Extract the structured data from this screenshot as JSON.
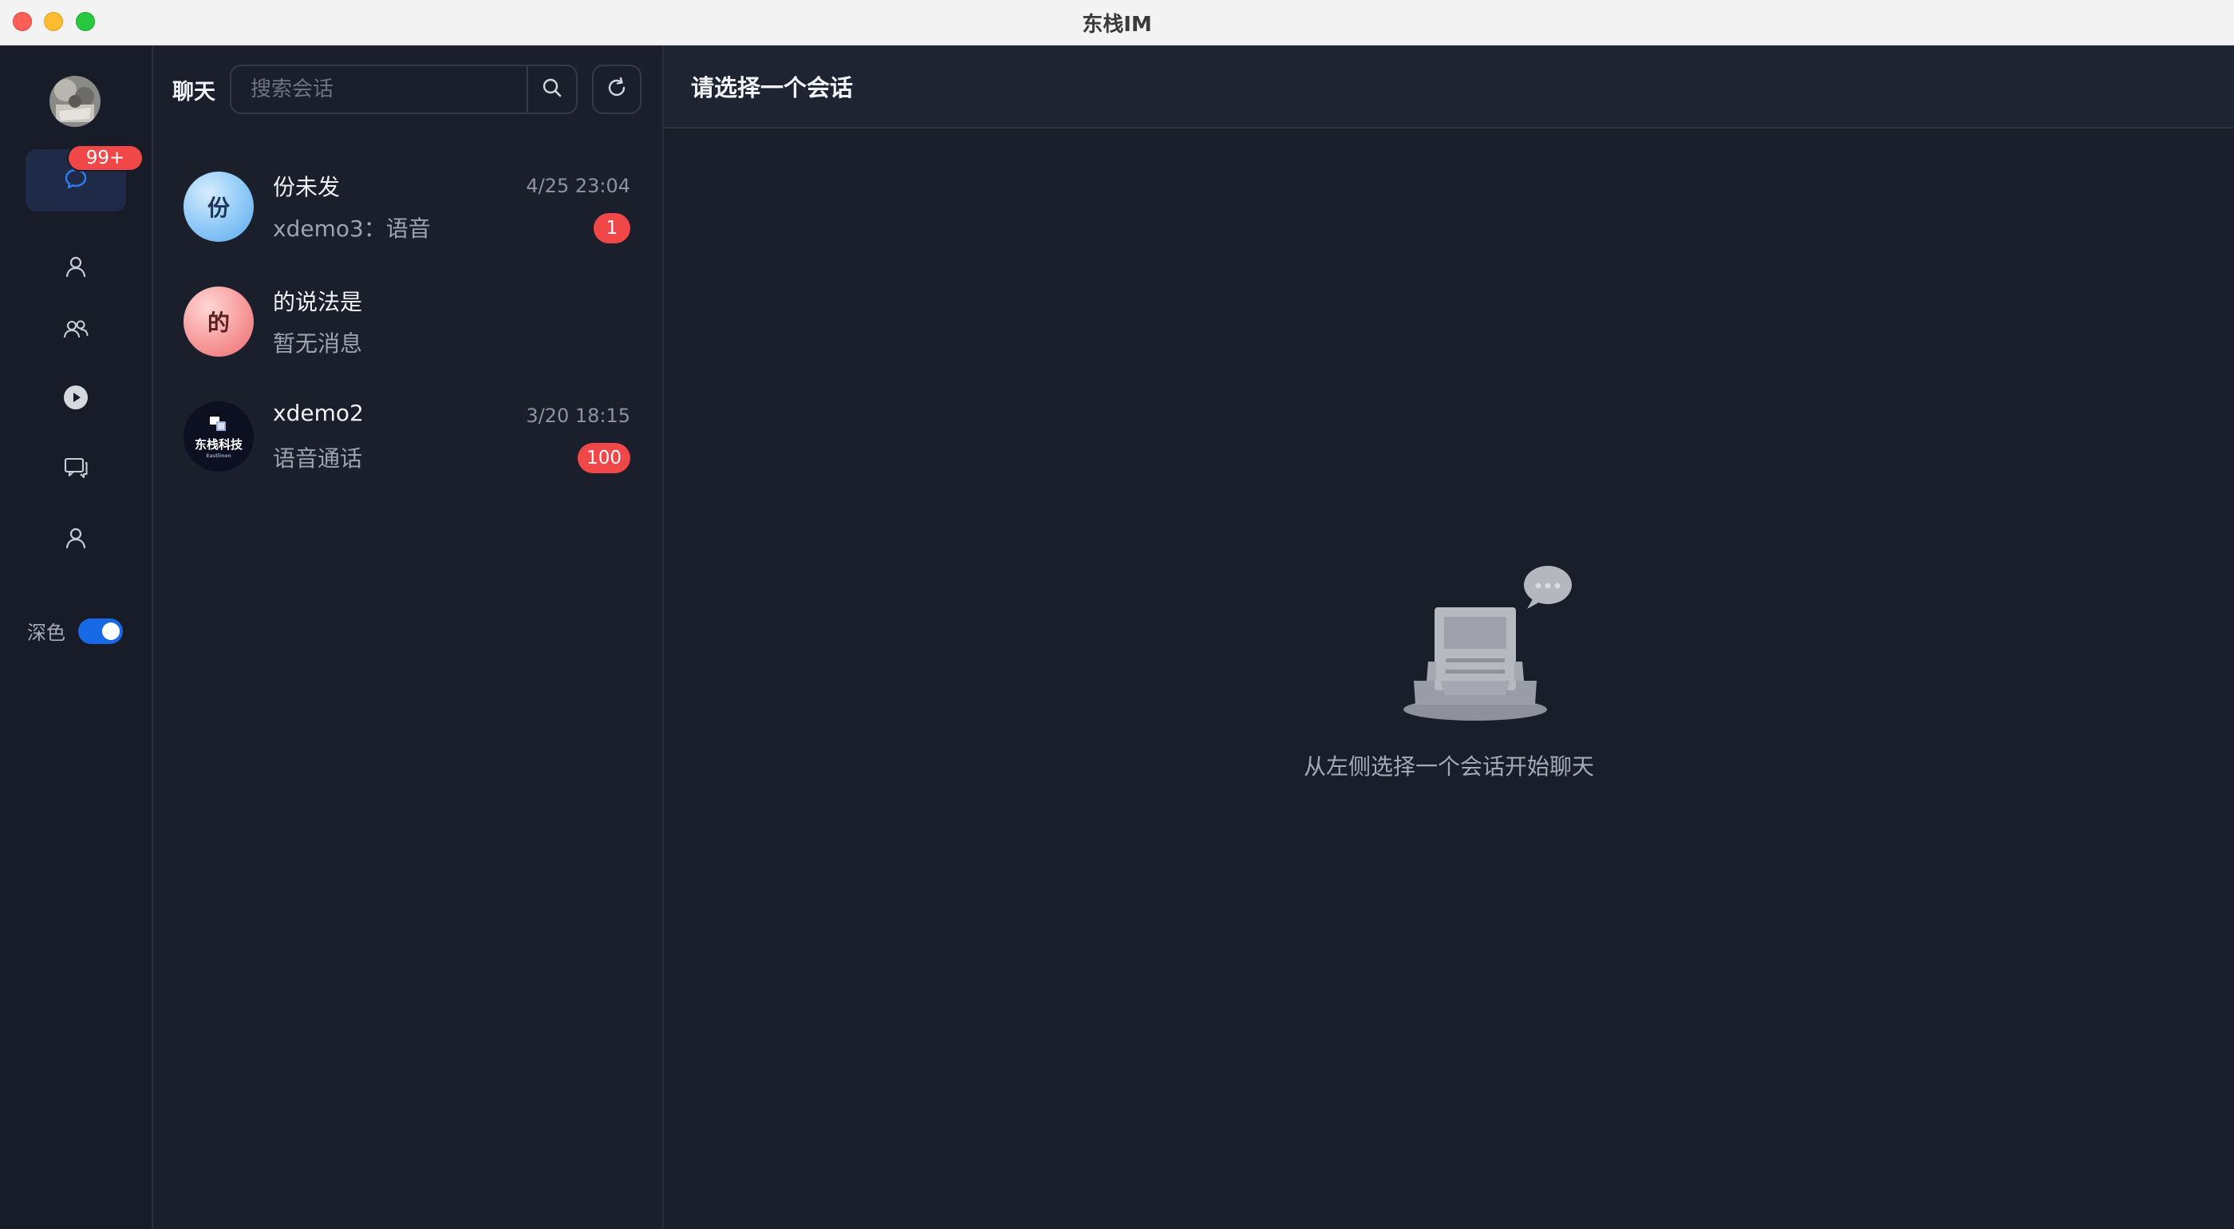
{
  "window": {
    "title": "东栈IM"
  },
  "nav": {
    "chat_badge": "99+",
    "theme_label": "深色",
    "theme_dark": true
  },
  "list": {
    "title": "聊天",
    "search_placeholder": "搜索会话",
    "conversations": [
      {
        "name": "份未发",
        "avatar_text": "份",
        "time": "4/25 23:04",
        "preview": "xdemo3：语音",
        "unread": "1"
      },
      {
        "name": "的说法是",
        "avatar_text": "的",
        "time": "",
        "preview": "暂无消息",
        "unread": ""
      },
      {
        "name": "xdemo2",
        "avatar_text": "东栈科技",
        "avatar_subtext": "Eastlinen",
        "time": "3/20 18:15",
        "preview": "语音通话",
        "unread": "100"
      }
    ]
  },
  "main": {
    "header_title": "请选择一个会话",
    "empty_text": "从左侧选择一个会话开始聊天"
  },
  "icons": [
    "close-icon",
    "minimize-icon",
    "zoom-icon",
    "chat-bubble-icon",
    "user-icon",
    "group-icon",
    "play-icon",
    "messages-icon",
    "profile-icon",
    "search-icon",
    "refresh-icon",
    "empty-inbox-icon"
  ],
  "colors": {
    "accent": "#1769e6",
    "badge": "#f04848",
    "background": "#1a1e2b"
  }
}
